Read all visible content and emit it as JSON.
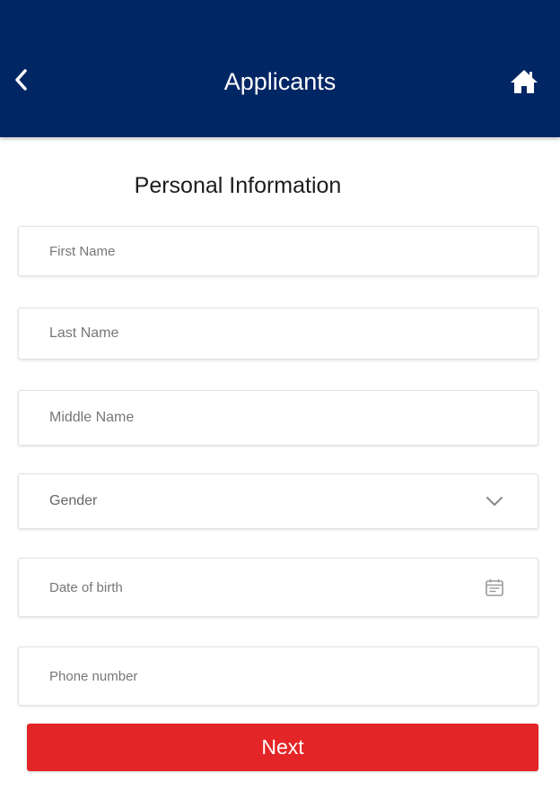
{
  "header": {
    "title": "Applicants",
    "back_icon": "chevron-left-icon",
    "home_icon": "home-icon",
    "background": "#002663"
  },
  "form": {
    "section_title": "Personal Information",
    "first_name": {
      "placeholder": "First Name",
      "value": ""
    },
    "last_name": {
      "placeholder": "Last Name",
      "value": ""
    },
    "middle_name": {
      "placeholder": "Middle Name",
      "value": ""
    },
    "gender": {
      "label": "Gender",
      "icon": "chevron-down-icon"
    },
    "date_of_birth": {
      "placeholder": "Date of birth",
      "value": "",
      "icon": "calendar-icon"
    },
    "phone_number": {
      "placeholder": "Phone number",
      "value": ""
    }
  },
  "actions": {
    "next_label": "Next",
    "next_color": "#e42527"
  }
}
